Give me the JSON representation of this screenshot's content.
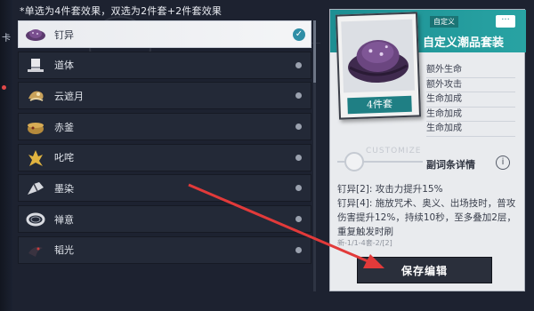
{
  "hint": "*单选为4件套效果，双选为2件套+2件套效果",
  "side_mark": "卡",
  "sets": [
    {
      "name": "钉异",
      "icon": "purple-hat-icon",
      "selected": true
    },
    {
      "name": "道体",
      "icon": "top-hat-icon",
      "selected": false
    },
    {
      "name": "云遮月",
      "icon": "cloud-moon-icon",
      "selected": false
    },
    {
      "name": "赤釜",
      "icon": "red-cauldron-icon",
      "selected": false
    },
    {
      "name": "叱咤",
      "icon": "flame-icon",
      "selected": false
    },
    {
      "name": "墨染",
      "icon": "ink-brush-icon",
      "selected": false
    },
    {
      "name": "禅意",
      "icon": "ring-icon",
      "selected": false
    },
    {
      "name": "韬光",
      "icon": "dark-bird-icon",
      "selected": false
    }
  ],
  "panel": {
    "custom_tag": "自定义",
    "more_label": "···",
    "set_title": "自定义潮品套装",
    "card_label": "4件套",
    "stats": [
      "额外生命",
      "额外攻击",
      "生命加成",
      "生命加成",
      "生命加成"
    ],
    "ghost_text": "CUSTOMIZE",
    "detail_label": "副词条详情",
    "info_symbol": "i",
    "effects": [
      "钉异[2]: 攻击力提升15%",
      "钉异[4]: 施放咒术、奥义、出场技时，普攻伤害提升12%，持续10秒，至多叠加2层，重复触发时刷"
    ],
    "effects_small": "新-1/1-4套-2/[2]",
    "save_label": "保存编辑"
  },
  "colors": {
    "teal": "#1d8f93",
    "check": "#2f8ea6",
    "arrow": "#e23a3a"
  }
}
